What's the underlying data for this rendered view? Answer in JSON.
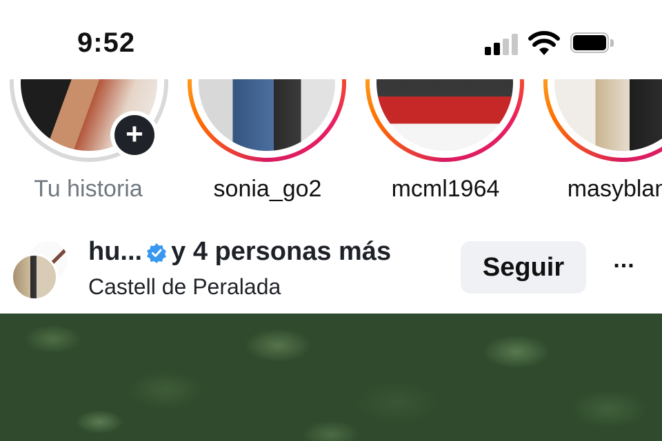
{
  "status_bar": {
    "time": "9:52",
    "signal_bars": 2,
    "battery_level": 1.0
  },
  "stories": [
    {
      "label": "Tu historia",
      "ring": "none",
      "has_add_button": true
    },
    {
      "label": "sonia_go2",
      "ring": "gradient"
    },
    {
      "label": "mcml1964",
      "ring": "gradient"
    },
    {
      "label": "masyblanc",
      "ring": "gradient"
    }
  ],
  "story_add_icon": "+",
  "post": {
    "author": "hu...",
    "connector": "y",
    "others": "4 personas más",
    "location": "Castell de Peralada",
    "follow_label": "Seguir",
    "more_label": "...",
    "verified_icon": "verified-badge-icon"
  },
  "colors": {
    "accent_verified": "#3897f0",
    "follow_button_bg": "#eff1f5",
    "muted_text": "#6f7780"
  }
}
